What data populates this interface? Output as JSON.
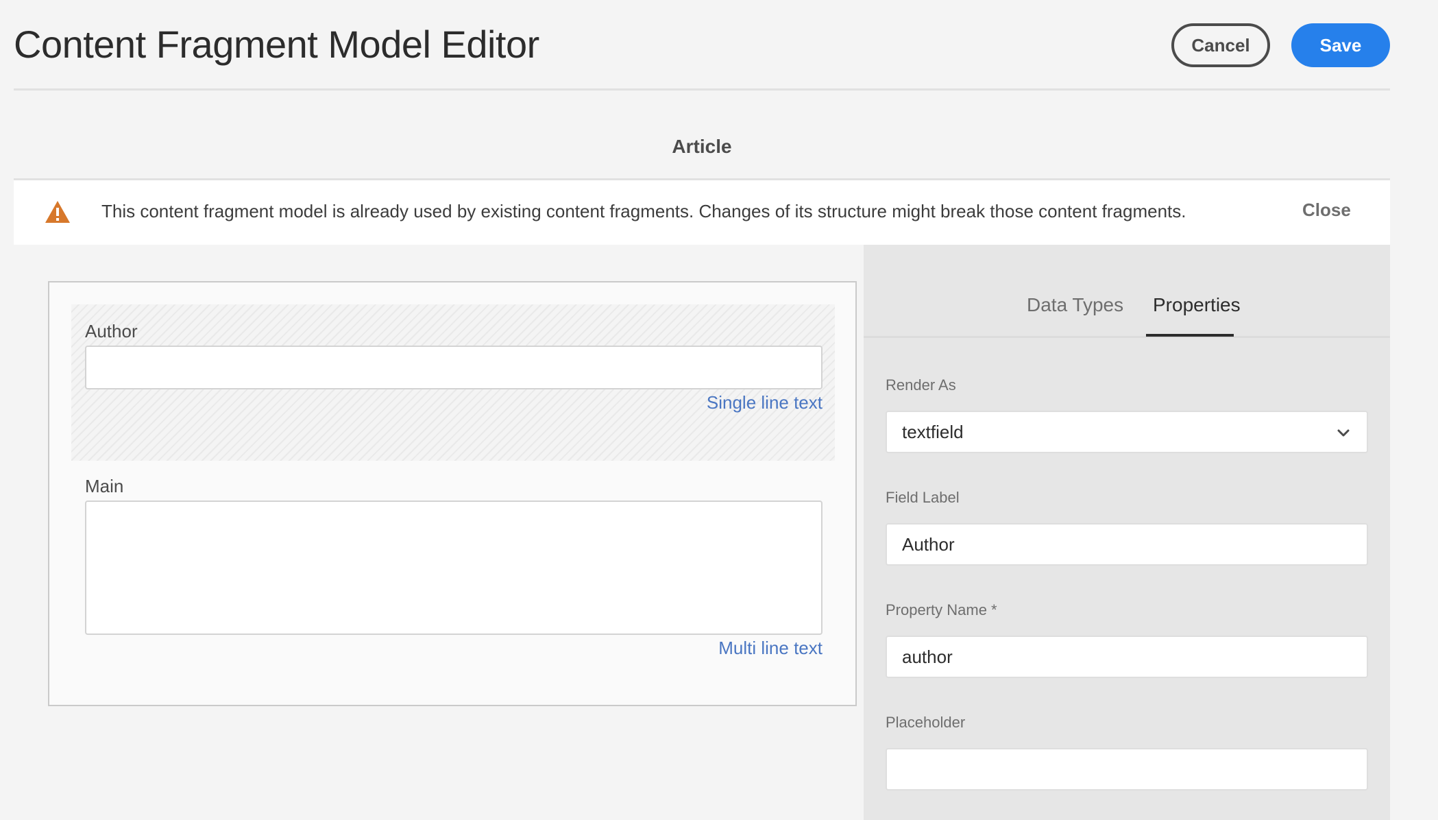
{
  "header": {
    "title": "Content Fragment Model Editor",
    "cancel_label": "Cancel",
    "save_label": "Save"
  },
  "model": {
    "name": "Article"
  },
  "alert": {
    "message": "This content fragment model is already used by existing content fragments. Changes of its structure might break those content fragments.",
    "close_label": "Close",
    "icon": "alert-triangle-icon",
    "color": "#d7782b"
  },
  "canvas": {
    "fields": [
      {
        "label": "Author",
        "type": "Single line text",
        "value": ""
      },
      {
        "label": "Main",
        "type": "Multi line text",
        "value": ""
      }
    ]
  },
  "panel": {
    "tabs": [
      {
        "label": "Data Types",
        "active": false
      },
      {
        "label": "Properties",
        "active": true
      }
    ],
    "properties": {
      "render_as": {
        "label": "Render As",
        "value": "textfield"
      },
      "field_label": {
        "label": "Field Label",
        "value": "Author"
      },
      "property_name": {
        "label": "Property Name *",
        "value": "author"
      },
      "placeholder": {
        "label": "Placeholder",
        "value": ""
      }
    }
  },
  "colors": {
    "accent": "#2680eb",
    "link": "#4a76c2"
  }
}
